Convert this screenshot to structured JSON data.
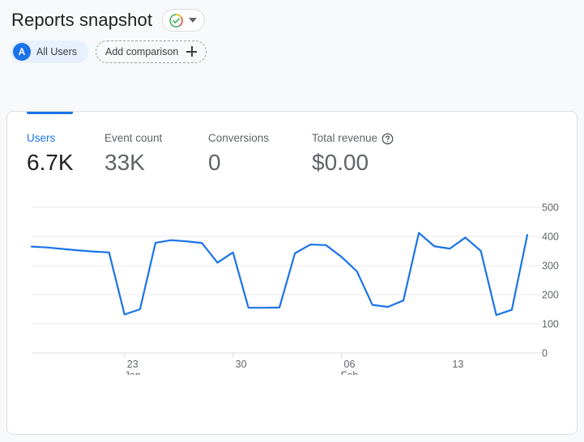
{
  "header": {
    "title": "Reports snapshot",
    "insights_icon": "check-circle-icon",
    "dropdown_icon": "chevron-down-icon"
  },
  "comparison": {
    "all_users_avatar": "A",
    "all_users_label": "All Users",
    "add_comparison_label": "Add comparison",
    "add_icon": "plus-icon"
  },
  "metrics": [
    {
      "label": "Users",
      "value": "6.7K",
      "active": true,
      "has_help": false
    },
    {
      "label": "Event count",
      "value": "33K",
      "active": false,
      "has_help": false
    },
    {
      "label": "Conversions",
      "value": "0",
      "active": false,
      "has_help": false
    },
    {
      "label": "Total revenue",
      "value": "$0.00",
      "active": false,
      "has_help": true
    }
  ],
  "colors": {
    "accent": "#1a73e8",
    "line": "#1a73e8",
    "text_primary": "#202124",
    "text_secondary": "#5f6368",
    "grid": "#e8eaed",
    "chip_bg": "#e8f0fe",
    "card_border": "#e0e0e0",
    "page_bg": "#f8f9fa"
  },
  "chart_data": {
    "type": "line",
    "title": "",
    "xlabel": "",
    "ylabel": "",
    "ylim": [
      0,
      500
    ],
    "y_ticks": [
      500,
      400,
      300,
      200,
      100,
      0
    ],
    "grid": true,
    "legend": "none",
    "x_tick_labels": [
      {
        "top": "23",
        "bottom": "Jan"
      },
      {
        "top": "30",
        "bottom": ""
      },
      {
        "top": "06",
        "bottom": "Feb"
      },
      {
        "top": "13",
        "bottom": ""
      }
    ],
    "x_tick_indices": [
      6,
      13,
      20,
      27
    ],
    "series": [
      {
        "name": "Users",
        "color": "#1a73e8",
        "values": [
          365,
          362,
          357,
          352,
          348,
          345,
          132,
          150,
          378,
          387,
          383,
          377,
          310,
          345,
          155,
          155,
          156,
          342,
          372,
          370,
          330,
          280,
          165,
          158,
          180,
          412,
          366,
          358,
          396,
          350,
          130,
          148,
          405
        ]
      }
    ]
  }
}
